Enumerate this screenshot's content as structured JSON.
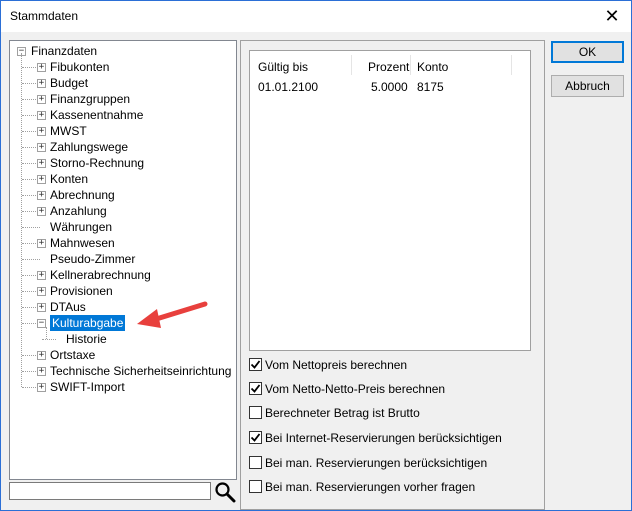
{
  "window": {
    "title": "Stammdaten",
    "close_label": "✕"
  },
  "tree": {
    "root": "Finanzdaten",
    "items": [
      {
        "label": "Fibukonten",
        "expander": "+"
      },
      {
        "label": "Budget",
        "expander": "+"
      },
      {
        "label": "Finanzgruppen",
        "expander": "+"
      },
      {
        "label": "Kassenentnahme",
        "expander": "+"
      },
      {
        "label": "MWST",
        "expander": "+"
      },
      {
        "label": "Zahlungswege",
        "expander": "+"
      },
      {
        "label": "Storno-Rechnung",
        "expander": "+"
      },
      {
        "label": "Konten",
        "expander": "+"
      },
      {
        "label": "Abrechnung",
        "expander": "+"
      },
      {
        "label": "Anzahlung",
        "expander": "+"
      },
      {
        "label": "Währungen",
        "expander": ""
      },
      {
        "label": "Mahnwesen",
        "expander": "+"
      },
      {
        "label": "Pseudo-Zimmer",
        "expander": ""
      },
      {
        "label": "Kellnerabrechnung",
        "expander": "+"
      },
      {
        "label": "Provisionen",
        "expander": "+"
      },
      {
        "label": "DTAus",
        "expander": "+"
      },
      {
        "label": "Kulturabgabe",
        "expander": "−",
        "selected": true
      },
      {
        "label": "Historie",
        "expander": "",
        "child": true
      },
      {
        "label": "Ortstaxe",
        "expander": "+"
      },
      {
        "label": "Technische Sicherheitseinrichtung",
        "expander": "+"
      },
      {
        "label": "SWIFT-Import",
        "expander": "+"
      }
    ]
  },
  "search": {
    "value": ""
  },
  "grid": {
    "headers": [
      "Gültig bis",
      "Prozent",
      "Konto"
    ],
    "rows": [
      [
        "01.01.2100",
        "5.0000",
        "8175"
      ]
    ]
  },
  "options": [
    {
      "label": "Vom Nettopreis berechnen",
      "checked": true
    },
    {
      "label": "Vom Netto-Netto-Preis berechnen",
      "checked": true
    },
    {
      "label": "Berechneter Betrag ist Brutto",
      "checked": false
    },
    {
      "label": "Bei Internet-Reservierungen berücksichtigen",
      "checked": true
    },
    {
      "label": "Bei man. Reservierungen berücksichtigen",
      "checked": false
    },
    {
      "label": "Bei man. Reservierungen vorher fragen",
      "checked": false
    }
  ],
  "buttons": {
    "ok": "OK",
    "cancel": "Abbruch"
  },
  "colors": {
    "selection": "#0078d7",
    "arrow": "#e8403d",
    "window_border": "#2b6fd6"
  }
}
